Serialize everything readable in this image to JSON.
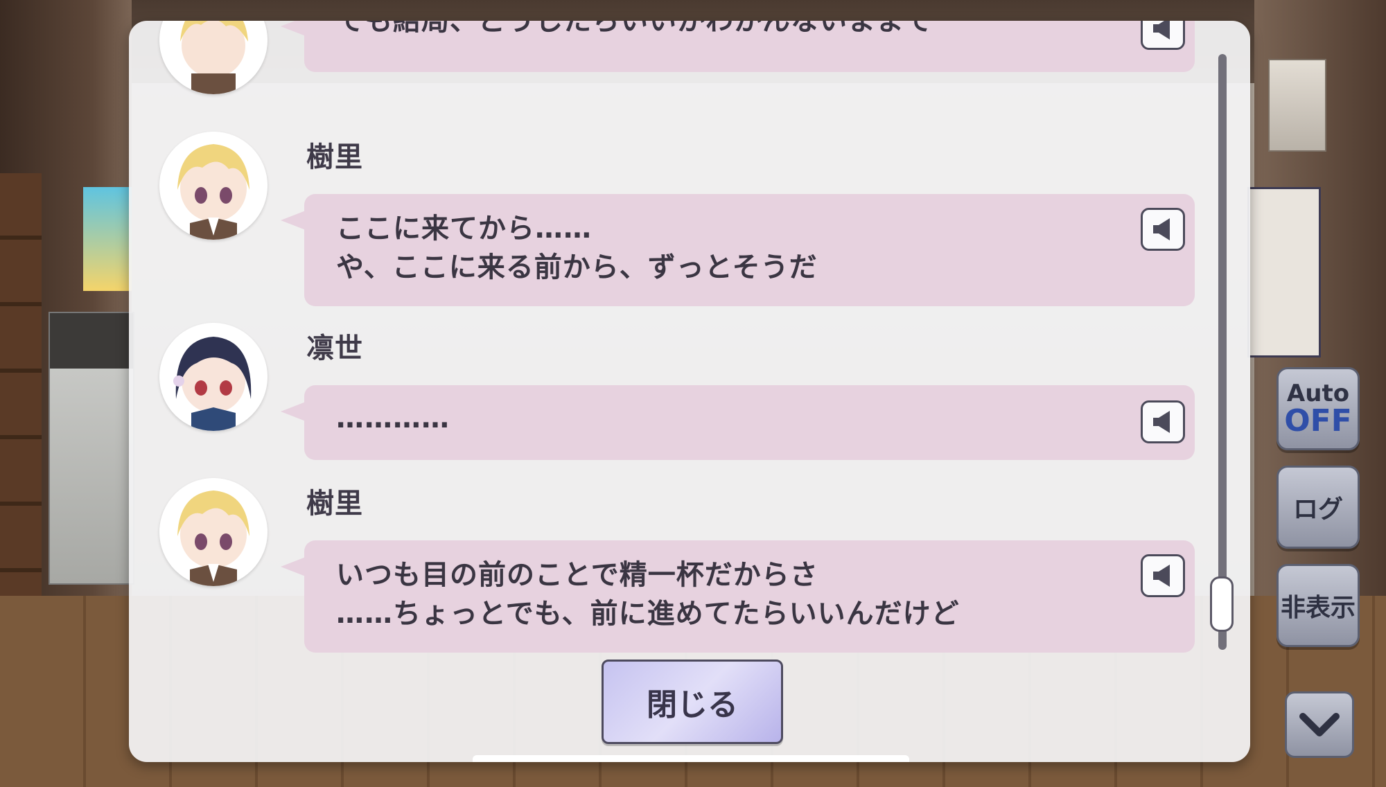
{
  "log": {
    "entries": [
      {
        "speaker": "",
        "lines": [
          "でも結局、どうしたらいいかわかんないままで"
        ],
        "avatar": "juri-avatar"
      },
      {
        "speaker": "樹里",
        "lines": [
          "ここに来てから……",
          "や、ここに来る前から、ずっとそうだ"
        ],
        "avatar": "juri-avatar"
      },
      {
        "speaker": "凛世",
        "lines": [
          "…………"
        ],
        "avatar": "rinze-avatar"
      },
      {
        "speaker": "樹里",
        "lines": [
          "いつも目の前のことで精一杯だからさ",
          "……ちょっとでも、前に進めてたらいいんだけど"
        ],
        "avatar": "juri-avatar"
      }
    ],
    "close_label": "閉じる"
  },
  "controls": {
    "auto_label": "Auto",
    "auto_state": "OFF",
    "log_label": "ログ",
    "hide_label": "非表示"
  },
  "colors": {
    "bubble": "#e7d2df",
    "panel": "#f4f4f5",
    "auto_state": "#2f4ea8"
  }
}
